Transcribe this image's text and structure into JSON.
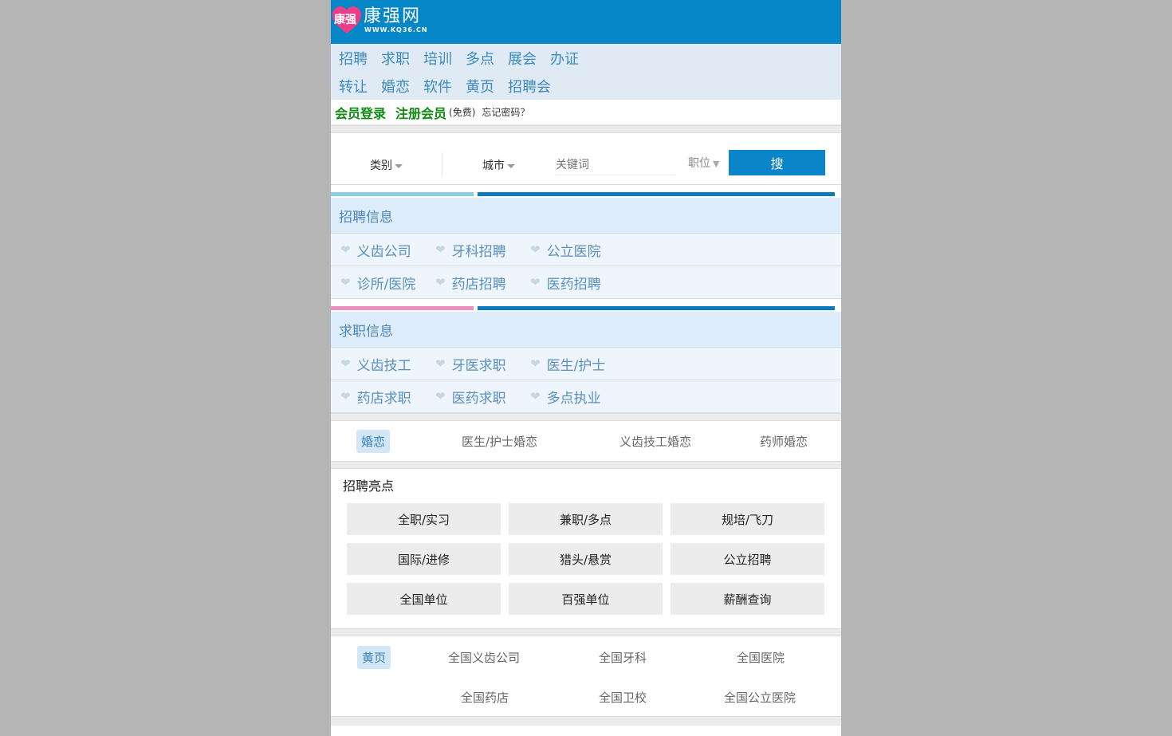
{
  "logo": {
    "badge": "康强",
    "name": "康强网",
    "url": "WWW.KQ36.CN"
  },
  "colors": {
    "header": "#0586c6",
    "nav_bg": "#dfeaf5",
    "accent_green": "#0f8a12",
    "search_button": "#0a85c9",
    "bar_light_blue": "#8bcbe4",
    "bar_pink": "#ea8fbf",
    "bar_blue": "#0a7bbd"
  },
  "nav": {
    "row1": [
      "招聘",
      "求职",
      "培训",
      "多点",
      "展会",
      "办证"
    ],
    "row2": [
      "转让",
      "婚恋",
      "软件",
      "黄页",
      "招聘会"
    ]
  },
  "login": {
    "login_label": "会员登录",
    "register_label": "注册会员",
    "free_note": "(免费)",
    "forgot": "忘记密码？"
  },
  "search": {
    "category": "类别",
    "city": "城市",
    "keyword_placeholder": "关键词",
    "position": "职位",
    "button": "搜"
  },
  "recruit": {
    "title": "招聘信息",
    "items": [
      [
        "义齿公司",
        "牙科招聘",
        "公立医院"
      ],
      [
        "诊所/医院",
        "药店招聘",
        "医药招聘"
      ]
    ]
  },
  "jobseek": {
    "title": "求职信息",
    "items": [
      [
        "义齿技工",
        "牙医求职",
        "医生/护士"
      ],
      [
        "药店求职",
        "医药求职",
        "多点执业"
      ]
    ]
  },
  "marriage": {
    "tabs": [
      "婚恋",
      "医生/护士婚恋",
      "义齿技工婚恋",
      "药师婚恋"
    ]
  },
  "highlights": {
    "title": "招聘亮点",
    "cells": [
      "全职/实习",
      "兼职/多点",
      "规培/飞刀",
      "国际/进修",
      "猎头/悬赏",
      "公立招聘",
      "全国单位",
      "百强单位",
      "薪酬查询"
    ]
  },
  "yellow_pages": {
    "tabs": [
      "黄页",
      "全国义齿公司",
      "全国牙科",
      "全国医院",
      "全国药店",
      "全国卫校",
      "全国公立医院"
    ]
  },
  "icons": {
    "heart": "heart-icon",
    "caret": "caret-down-icon"
  }
}
